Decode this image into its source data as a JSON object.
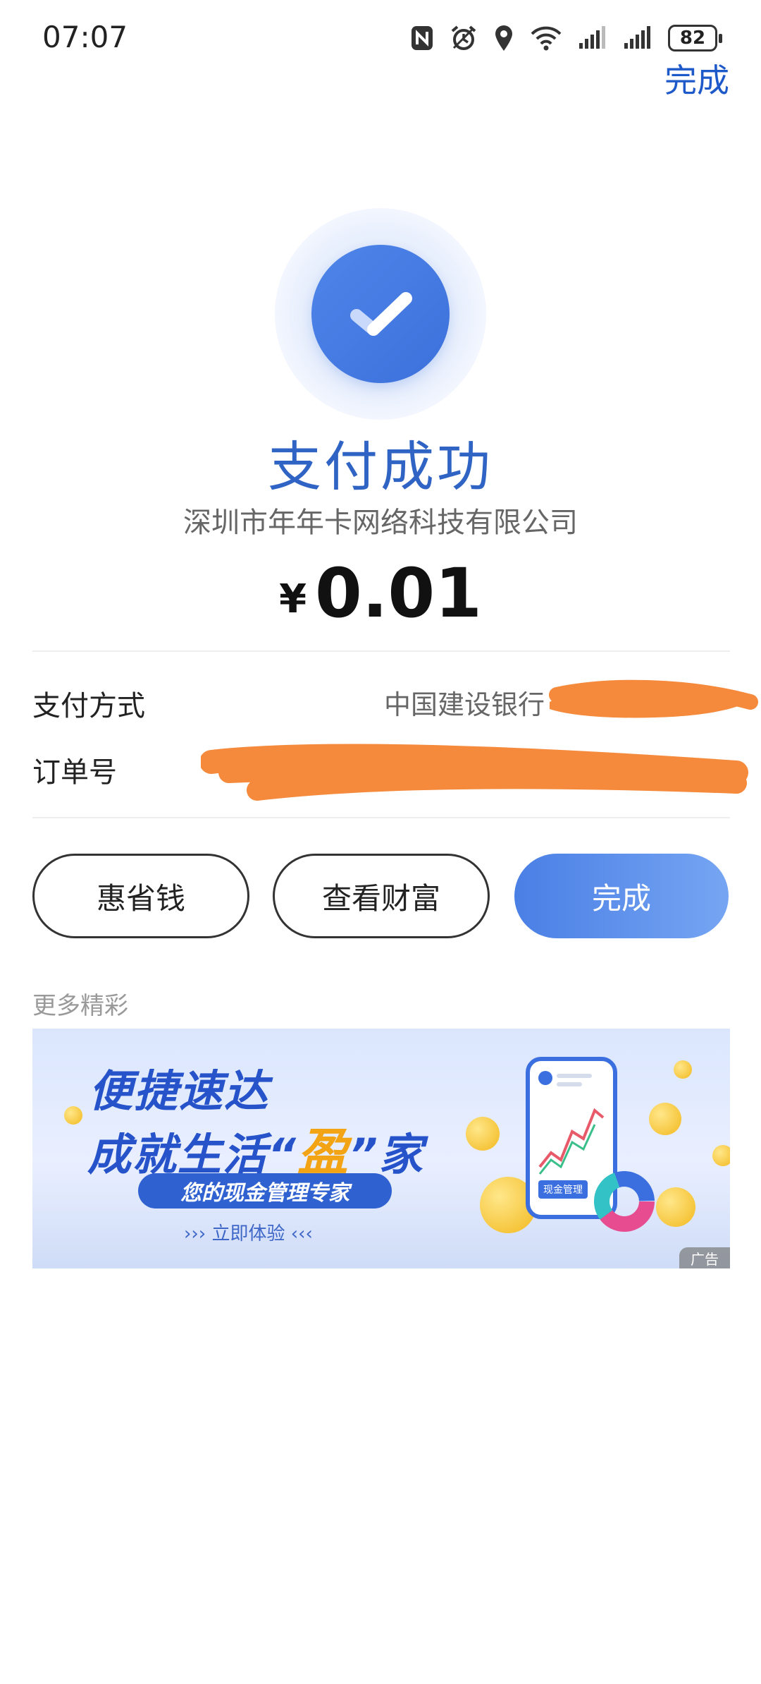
{
  "status_bar": {
    "time": "07:07",
    "battery": "82",
    "icons": [
      "nfc-icon",
      "alarm-icon",
      "location-icon",
      "wifi-icon",
      "signal-icon",
      "signal-icon",
      "battery-icon"
    ]
  },
  "header": {
    "done_label": "完成"
  },
  "result": {
    "title": "支付成功",
    "merchant": "深圳市年年卡网络科技有限公司",
    "currency": "¥",
    "amount": "0.01"
  },
  "details": {
    "payment_method_label": "支付方式",
    "payment_method_value": "中国建设银行",
    "order_label": "订单号"
  },
  "actions": {
    "save_money": "惠省钱",
    "view_wealth": "查看财富",
    "done": "完成"
  },
  "more": {
    "title": "更多精彩",
    "banner": {
      "line1": "便捷速达",
      "line2_pre": "成就生活“",
      "line2_highlight": "盈",
      "line2_post": "”家",
      "pill": "您的现金管理专家",
      "cta": "››› 立即体验 ‹‹‹",
      "phone_label": "现金管理",
      "ad_tag": "广告"
    }
  },
  "colors": {
    "accent": "#2f63c4",
    "button_gradient_start": "#4a7fe5",
    "button_gradient_end": "#76a5f3",
    "redaction": "#f58a3c"
  }
}
